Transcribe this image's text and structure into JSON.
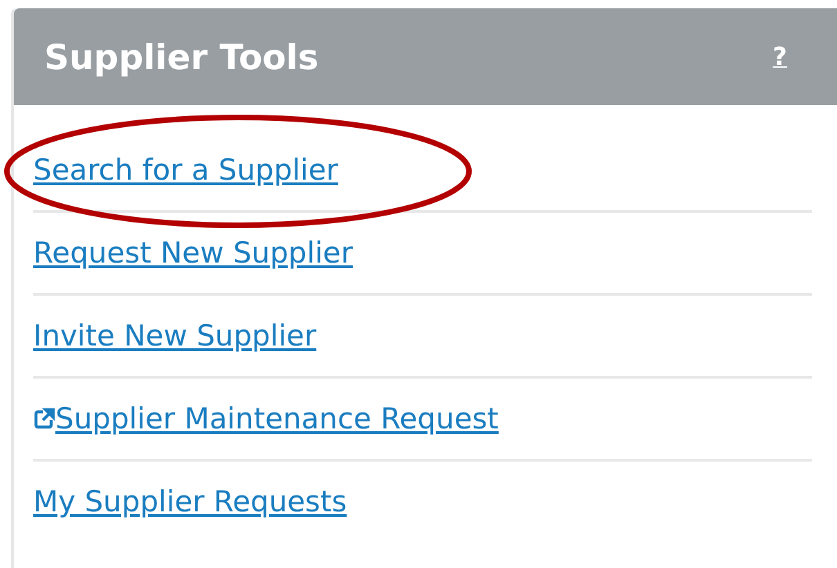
{
  "panel": {
    "title": "Supplier Tools",
    "help": "?"
  },
  "links": [
    {
      "label": "Search for a Supplier",
      "external": false,
      "highlighted": true
    },
    {
      "label": "Request New Supplier",
      "external": false,
      "highlighted": false
    },
    {
      "label": "Invite New Supplier",
      "external": false,
      "highlighted": false
    },
    {
      "label": "Supplier Maintenance Request",
      "external": true,
      "highlighted": false
    },
    {
      "label": "My Supplier Requests",
      "external": false,
      "highlighted": false
    }
  ]
}
